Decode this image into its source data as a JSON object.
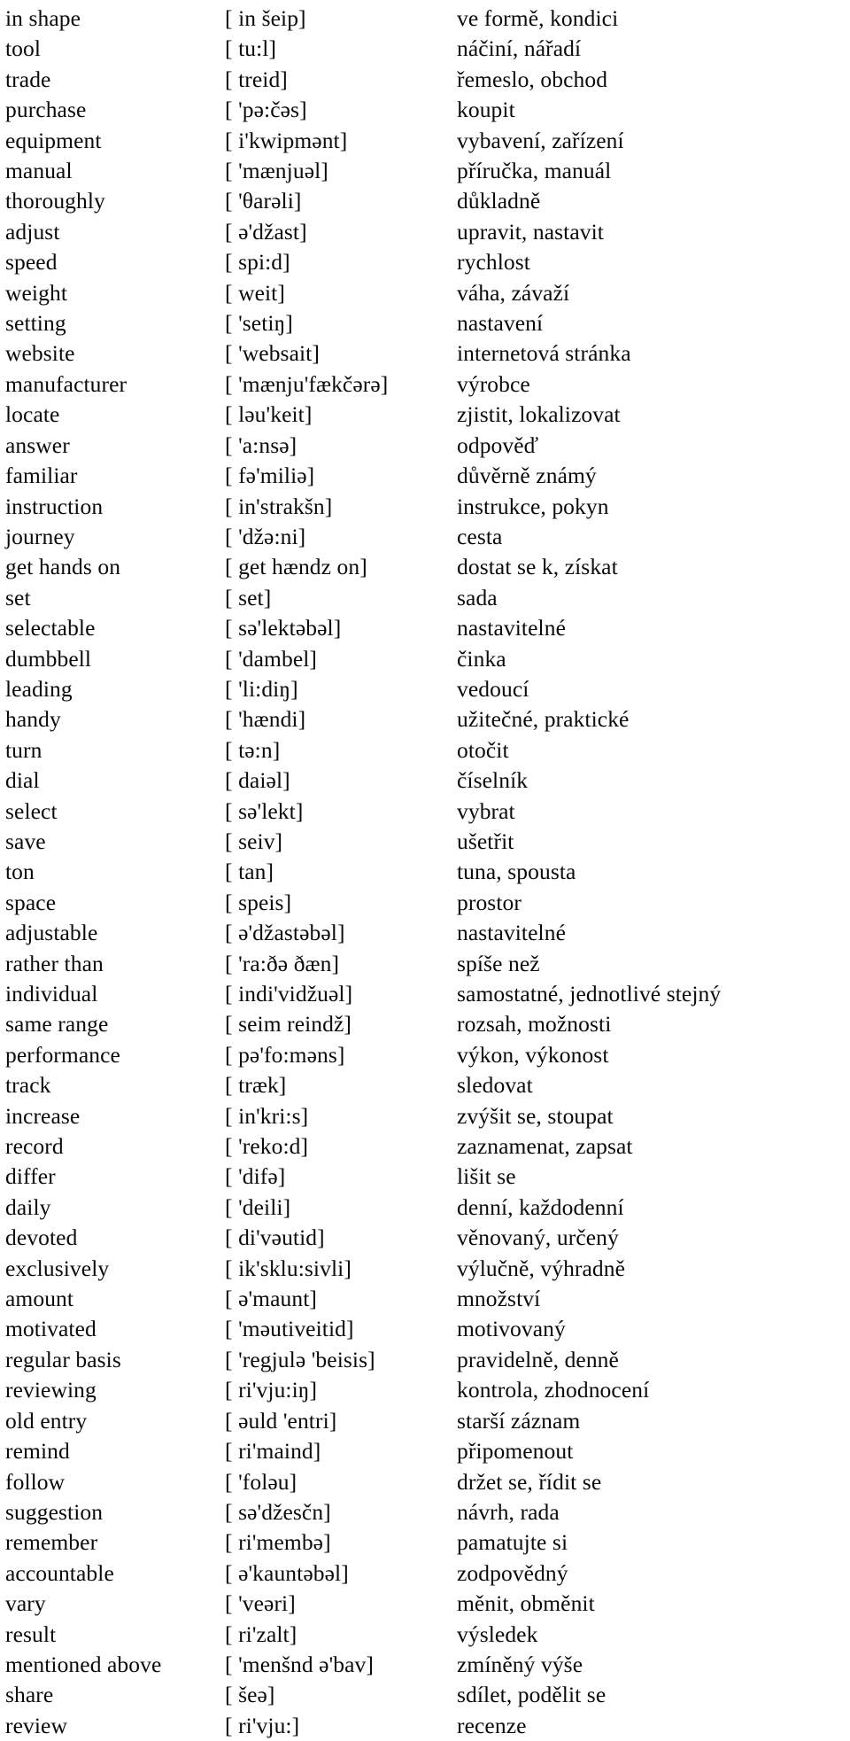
{
  "document": {
    "type": "vocabulary-list",
    "language_pair": "English - Czech",
    "columns": [
      "term",
      "phonetic",
      "translation"
    ],
    "row_count": 55,
    "rows": [
      {
        "term": "in shape",
        "phonetic": "[ in šeip]",
        "translation": "ve formě, kondici"
      },
      {
        "term": "tool",
        "phonetic": "[ tu:l]",
        "translation": "náčiní, nářadí"
      },
      {
        "term": "trade",
        "phonetic": "[ treid]",
        "translation": "řemeslo, obchod"
      },
      {
        "term": "purchase",
        "phonetic": "[ 'pə:čəs]",
        "translation": "koupit"
      },
      {
        "term": "equipment",
        "phonetic": "[ i'kwipmənt]",
        "translation": "vybavení, zařízení"
      },
      {
        "term": "manual",
        "phonetic": "[ 'mænjuəl]",
        "translation": "příručka, manuál"
      },
      {
        "term": "thoroughly",
        "phonetic": "[ 'θarəli]",
        "translation": "důkladně"
      },
      {
        "term": "adjust",
        "phonetic": "[ ə'džast]",
        "translation": "upravit, nastavit"
      },
      {
        "term": "speed",
        "phonetic": "[ spi:d]",
        "translation": "rychlost"
      },
      {
        "term": "weight",
        "phonetic": "[ weit]",
        "translation": "váha, závaží"
      },
      {
        "term": "setting",
        "phonetic": "[ 'setiŋ]",
        "translation": "nastavení"
      },
      {
        "term": "website",
        "phonetic": "[ 'websait]",
        "translation": "internetová stránka"
      },
      {
        "term": "manufacturer",
        "phonetic": "[ 'mænju'fækčərə]",
        "translation": "výrobce"
      },
      {
        "term": "locate",
        "phonetic": "[ ləu'keit]",
        "translation": "zjistit, lokalizovat"
      },
      {
        "term": "answer",
        "phonetic": "[ 'a:nsə]",
        "translation": "odpověď"
      },
      {
        "term": "familiar",
        "phonetic": "[ fə'miliə]",
        "translation": "důvěrně známý"
      },
      {
        "term": "instruction",
        "phonetic": "[ in'strakšn]",
        "translation": "instrukce, pokyn"
      },
      {
        "term": "journey",
        "phonetic": "[ 'džə:ni]",
        "translation": "cesta"
      },
      {
        "term": "get hands on",
        "phonetic": "[ get hændz on]",
        "translation": "dostat se k, získat"
      },
      {
        "term": "set",
        "phonetic": "[ set]",
        "translation": "sada"
      },
      {
        "term": "selectable",
        "phonetic": "[ sə'lektəbəl]",
        "translation": "nastavitelné"
      },
      {
        "term": "dumbbell",
        "phonetic": "[ 'dambel]",
        "translation": "činka"
      },
      {
        "term": "leading",
        "phonetic": "[ 'li:diŋ]",
        "translation": "vedoucí"
      },
      {
        "term": "handy",
        "phonetic": "[ 'hændi]",
        "translation": "užitečné, praktické"
      },
      {
        "term": "turn",
        "phonetic": "[ tə:n]",
        "translation": "otočit"
      },
      {
        "term": "dial",
        "phonetic": "[ daiəl]",
        "translation": "číselník"
      },
      {
        "term": "select",
        "phonetic": "[ sə'lekt]",
        "translation": "vybrat"
      },
      {
        "term": "save",
        "phonetic": "[ seiv]",
        "translation": "ušetřit"
      },
      {
        "term": "ton",
        "phonetic": "[ tan]",
        "translation": "tuna, spousta"
      },
      {
        "term": "space",
        "phonetic": "[ speis]",
        "translation": "prostor"
      },
      {
        "term": "adjustable",
        "phonetic": "[ ə'džastəbəl]",
        "translation": "nastavitelné"
      },
      {
        "term": "rather than",
        "phonetic": "[ 'ra:ðə ðæn]",
        "translation": "spíše než"
      },
      {
        "term": "individual",
        "phonetic": "[ indi'vidžuəl]",
        "translation": "samostatné, jednotlivé stejný"
      },
      {
        "term": "same range",
        "phonetic": "[ seim reindž]",
        "translation": "rozsah, možnosti"
      },
      {
        "term": "performance",
        "phonetic": "[ pə'fo:məns]",
        "translation": "výkon, výkonost"
      },
      {
        "term": "track",
        "phonetic": "[ træk]",
        "translation": "sledovat"
      },
      {
        "term": "increase",
        "phonetic": "[ in'kri:s]",
        "translation": "zvýšit se, stoupat"
      },
      {
        "term": "record",
        "phonetic": "[ 'reko:d]",
        "translation": "zaznamenat, zapsat"
      },
      {
        "term": "differ",
        "phonetic": "[ 'difə]",
        "translation": "lišit se"
      },
      {
        "term": "daily",
        "phonetic": "[ 'deili]",
        "translation": "denní, každodenní"
      },
      {
        "term": "devoted",
        "phonetic": "[ di'vəutid]",
        "translation": "věnovaný, určený"
      },
      {
        "term": "exclusively",
        "phonetic": "[ ik'sklu:sivli]",
        "translation": "výlučně, výhradně"
      },
      {
        "term": "amount",
        "phonetic": "[ ə'maunt]",
        "translation": "množství"
      },
      {
        "term": "motivated",
        "phonetic": "[ 'məutiveitid]",
        "translation": "motivovaný"
      },
      {
        "term": "regular basis",
        "phonetic": "[ 'regjulə 'beisis]",
        "translation": "pravidelně, denně"
      },
      {
        "term": "reviewing",
        "phonetic": "[ ri'vju:iŋ]",
        "translation": "kontrola, zhodnocení"
      },
      {
        "term": "old entry",
        "phonetic": "[ əuld 'entri]",
        "translation": "starší záznam"
      },
      {
        "term": "remind",
        "phonetic": "[ ri'maind]",
        "translation": "připomenout"
      },
      {
        "term": "follow",
        "phonetic": "[ 'foləu]",
        "translation": "držet se, řídit se"
      },
      {
        "term": "suggestion",
        "phonetic": "[ sə'džesčn]",
        "translation": "návrh, rada"
      },
      {
        "term": "remember",
        "phonetic": "[ ri'membə]",
        "translation": "pamatujte si"
      },
      {
        "term": "accountable",
        "phonetic": "[ ə'kauntəbəl]",
        "translation": "zodpovědný"
      },
      {
        "term": "vary",
        "phonetic": "[ 'veəri]",
        "translation": "měnit, obměnit"
      },
      {
        "term": "result",
        "phonetic": "[ ri'zalt]",
        "translation": "výsledek"
      },
      {
        "term": "mentioned above",
        "phonetic": "[ 'menšnd ə'bav]",
        "translation": "zmíněný výše"
      },
      {
        "term": "share",
        "phonetic": "[ šeə]",
        "translation": "sdílet, podělit se"
      },
      {
        "term": "review",
        "phonetic": "[ ri'vju:]",
        "translation": "recenze"
      }
    ]
  }
}
